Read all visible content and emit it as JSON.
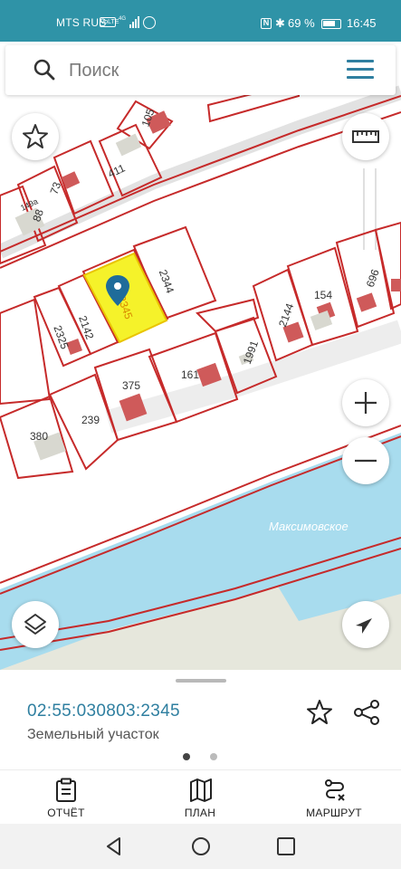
{
  "status_bar": {
    "carrier": "MTS RUS",
    "volte": "VoLTE",
    "network": "4G",
    "battery": "69 %",
    "time": "16:45"
  },
  "search": {
    "placeholder": "Поиск"
  },
  "map": {
    "plots": [
      "105",
      "411",
      "73",
      "88",
      "149a",
      "2344",
      "2345",
      "2142",
      "2325",
      "2144",
      "154",
      "696",
      "1991",
      "161",
      "375",
      "239",
      "380"
    ],
    "river_name": "Максимовское",
    "colors": {
      "plot_border": "#c62a2a",
      "selected_fill": "#f5f22a",
      "water": "#a8dcee",
      "marker": "#1f6c9a"
    }
  },
  "plot_info": {
    "cadastral_number": "02:55:030803:2345",
    "type": "Земельный участок",
    "pager": {
      "count": 2,
      "active": 1
    }
  },
  "bottom_nav": {
    "report": "ОТЧЁТ",
    "plan": "ПЛАН",
    "route": "МАРШРУТ"
  },
  "icons": [
    "search-icon",
    "menu-icon",
    "star-icon",
    "ruler-icon",
    "zoom-in-icon",
    "zoom-out-icon",
    "layers-icon",
    "location-arrow-icon",
    "share-icon",
    "report-icon",
    "map-icon",
    "route-icon",
    "back-icon",
    "home-icon",
    "recents-icon"
  ]
}
